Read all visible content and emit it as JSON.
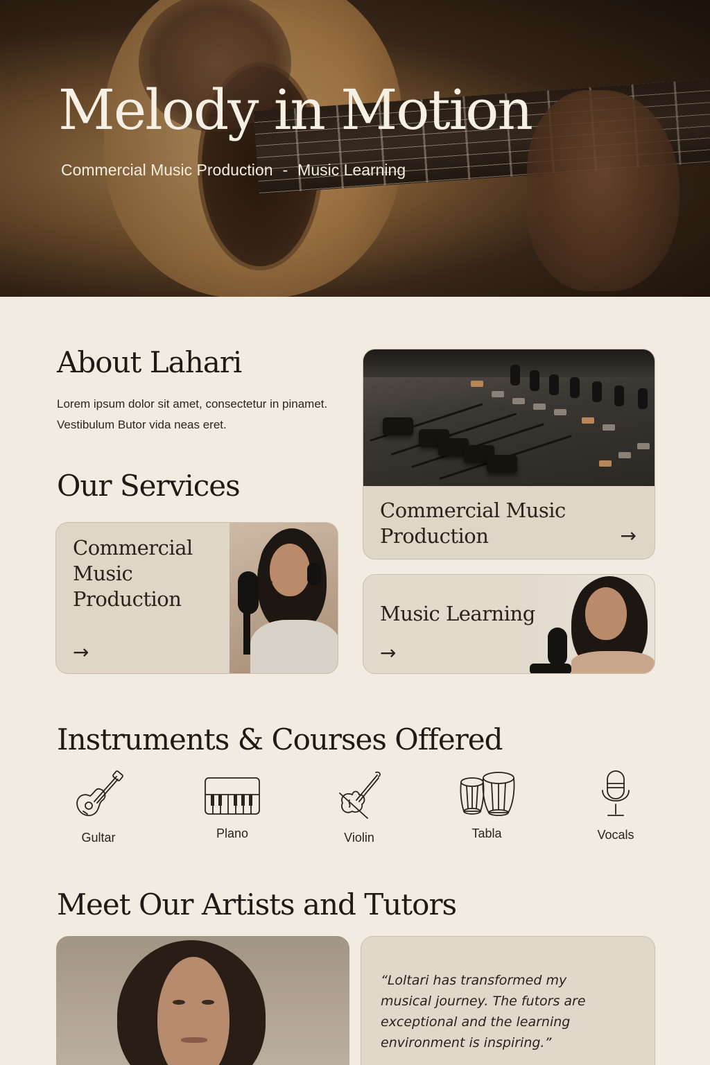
{
  "hero": {
    "title": "Melody in Motion",
    "subtitle_left": "Commercial Music Production",
    "subtitle_sep": "-",
    "subtitle_right": "Music Learning"
  },
  "about": {
    "title": "About Lahari",
    "text": "Lorem ipsum dolor sit amet, consectetur in pinamet. Vestibulum Butor vida neas eret."
  },
  "services": {
    "title": "Our Services",
    "cards": [
      {
        "label": "Commercial Music Production",
        "arrow": "→"
      },
      {
        "label": "Commercial Music Production",
        "arrow": "→"
      },
      {
        "label": "Music Learning",
        "arrow": "→"
      }
    ]
  },
  "instruments": {
    "title": "Instruments & Courses Offered",
    "items": [
      {
        "name": "Gultar",
        "icon": "guitar-icon"
      },
      {
        "name": "Plano",
        "icon": "piano-icon"
      },
      {
        "name": "Violin",
        "icon": "violin-icon"
      },
      {
        "name": "Tabla",
        "icon": "tabla-icon"
      },
      {
        "name": "Vocals",
        "icon": "microphone-icon"
      }
    ]
  },
  "artists": {
    "title": "Meet Our Artists and Tutors",
    "testimonial": "“Loltari has transformed my musical journey. The futors are exceptional and the learning environment is inspiring.”"
  },
  "colors": {
    "background": "#f1ebe2",
    "card": "#dfd6c8",
    "text": "#2a231c",
    "hero_text": "#f6efe4"
  }
}
